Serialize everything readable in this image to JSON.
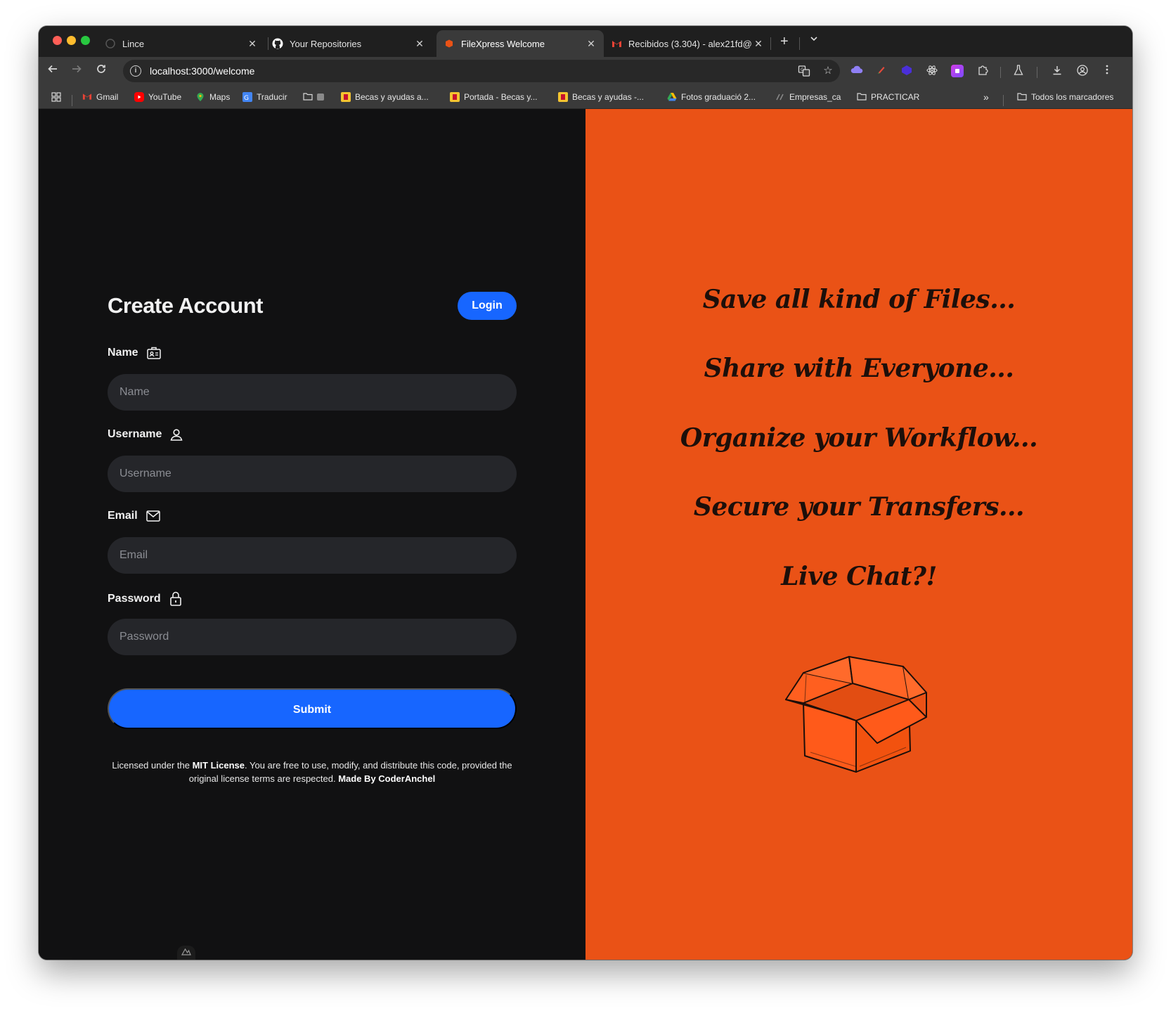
{
  "browser": {
    "tabs": [
      {
        "title": "Lince",
        "icon": "lince-favicon",
        "active": false
      },
      {
        "title": "Your Repositories",
        "icon": "github-icon",
        "active": false
      },
      {
        "title": "FileXpress Welcome",
        "icon": "filexpress-favicon",
        "active": true
      },
      {
        "title": "Recibidos (3.304) - alex21fd@",
        "icon": "gmail-icon",
        "active": false
      }
    ],
    "new_tab_label": "+",
    "url": "localhost:3000/welcome",
    "bookmarks": [
      {
        "label": "Gmail",
        "icon": "gmail-icon"
      },
      {
        "label": "YouTube",
        "icon": "youtube-icon"
      },
      {
        "label": "Maps",
        "icon": "maps-icon"
      },
      {
        "label": "Traducir",
        "icon": "translate-icon"
      },
      {
        "label": "",
        "icon": "folder-icon"
      },
      {
        "label": "Becas y ayudas a...",
        "icon": "spain-shield-icon"
      },
      {
        "label": "Portada - Becas y...",
        "icon": "spain-shield-icon"
      },
      {
        "label": "Becas y ayudas -...",
        "icon": "spain-shield-icon"
      },
      {
        "label": "Fotos graduació 2...",
        "icon": "drive-icon"
      },
      {
        "label": "Empresas_ca",
        "icon": "empresas-icon"
      },
      {
        "label": "PRACTICAR",
        "icon": "folder-icon"
      }
    ],
    "all_bookmarks_label": "Todos los marcadores",
    "overflow_label": "»"
  },
  "signup": {
    "title": "Create Account",
    "login_label": "Login",
    "fields": [
      {
        "label": "Name",
        "placeholder": "Name",
        "icon": "id-card-icon"
      },
      {
        "label": "Username",
        "placeholder": "Username",
        "icon": "user-icon"
      },
      {
        "label": "Email",
        "placeholder": "Email",
        "icon": "mail-icon"
      },
      {
        "label": "Password",
        "placeholder": "Password",
        "icon": "lock-icon"
      }
    ],
    "submit_label": "Submit",
    "license": {
      "prefix": "Licensed under the ",
      "license_name": "MIT License",
      "middle": ". You are free to use, modify, and distribute this code, provided the original license terms are respected. ",
      "credit": "Made By CoderAnchel"
    }
  },
  "promo": {
    "taglines": [
      "Save all kind of Files...",
      "Share with Everyone...",
      "Organize your Workflow...",
      "Secure your Transfers...",
      "Live Chat?!"
    ],
    "illustration": "open-box-icon"
  },
  "colors": {
    "accent_blue": "#1766ff",
    "promo_orange": "#ea5216",
    "panel_dark": "#111112",
    "input_bg": "#25262a"
  }
}
